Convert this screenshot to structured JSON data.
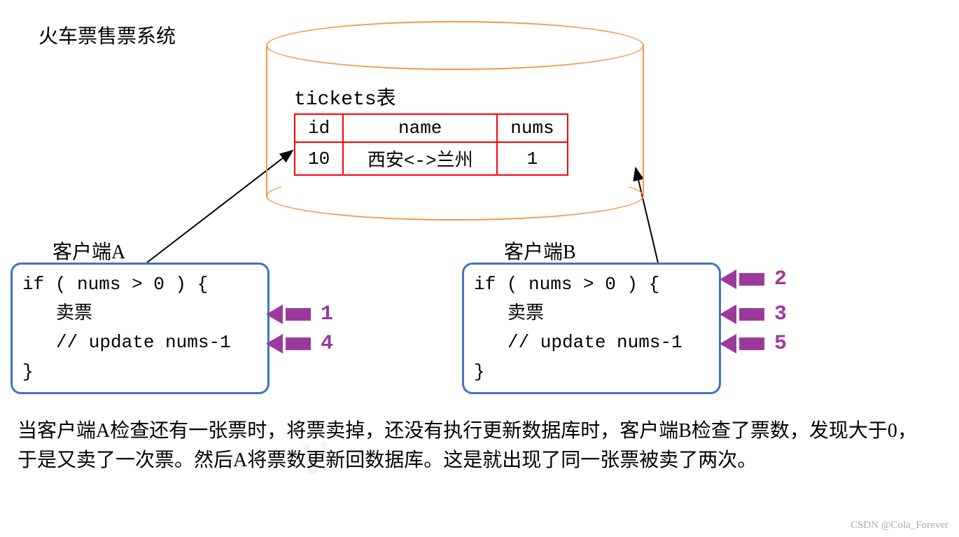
{
  "title": "火车票售票系统",
  "table": {
    "label": "tickets表",
    "headers": {
      "id": "id",
      "name": "name",
      "nums": "nums"
    },
    "row": {
      "id": "10",
      "name": "西安<->兰州",
      "nums": "1"
    }
  },
  "clientA": {
    "label": "客户端A",
    "line1": "if ( nums > 0 ) {",
    "line2": "卖票",
    "line3": "// update nums-1",
    "line4": "}"
  },
  "clientB": {
    "label": "客户端B",
    "line1": "if ( nums > 0 ) {",
    "line2": "卖票",
    "line3": "// update nums-1",
    "line4": "}"
  },
  "arrows": {
    "n1": "1",
    "n2": "2",
    "n3": "3",
    "n4": "4",
    "n5": "5"
  },
  "explanation": "当客户端A检查还有一张票时，将票卖掉，还没有执行更新数据库时，客户端B检查了票数，发现大于0，于是又卖了一次票。然后A将票数更新回数据库。这是就出现了同一张票被卖了两次。",
  "watermark": "CSDN @Cola_Forever"
}
